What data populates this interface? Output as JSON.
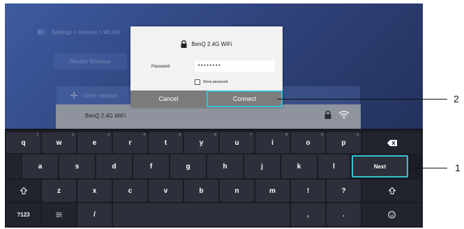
{
  "settings": {
    "breadcrumb": "Settings > Internet > WLAN",
    "restart_button": "Restart Wireless",
    "other_network": "Other network"
  },
  "network_row": {
    "ssid": "BenQ 2.4G WiFi"
  },
  "dialog": {
    "title": "BenQ 2.4G WiFi",
    "password_label": "Password",
    "password_value": "••••••••",
    "show_password_label": "Show password",
    "cancel_label": "Cancel",
    "connect_label": "Connect"
  },
  "keyboard": {
    "row1": [
      {
        "label": "q",
        "hint": "1"
      },
      {
        "label": "w",
        "hint": "2"
      },
      {
        "label": "e",
        "hint": "3"
      },
      {
        "label": "r",
        "hint": "4"
      },
      {
        "label": "t",
        "hint": "5"
      },
      {
        "label": "y",
        "hint": "6"
      },
      {
        "label": "u",
        "hint": "7"
      },
      {
        "label": "i",
        "hint": "8"
      },
      {
        "label": "o",
        "hint": "9"
      },
      {
        "label": "p",
        "hint": "0"
      }
    ],
    "row2": [
      "a",
      "s",
      "d",
      "f",
      "g",
      "h",
      "j",
      "k",
      "l"
    ],
    "row3": [
      "z",
      "x",
      "c",
      "v",
      "b",
      "n",
      "m",
      "!",
      "?"
    ],
    "next_label": "Next",
    "symbols_label": "?123",
    "slash_label": "/",
    "comma_label": ",",
    "period_label": "."
  },
  "callouts": {
    "connect_marker": "2",
    "next_marker": "1"
  },
  "colors": {
    "highlight": "#35c3cf",
    "key_background": "#2d303b",
    "keyboard_background": "#1a1c26"
  },
  "icons": [
    "back-icon",
    "lock-icon",
    "wifi-icon",
    "add-icon",
    "backspace-icon",
    "shift-icon",
    "emoji-icon",
    "settings-icon"
  ]
}
